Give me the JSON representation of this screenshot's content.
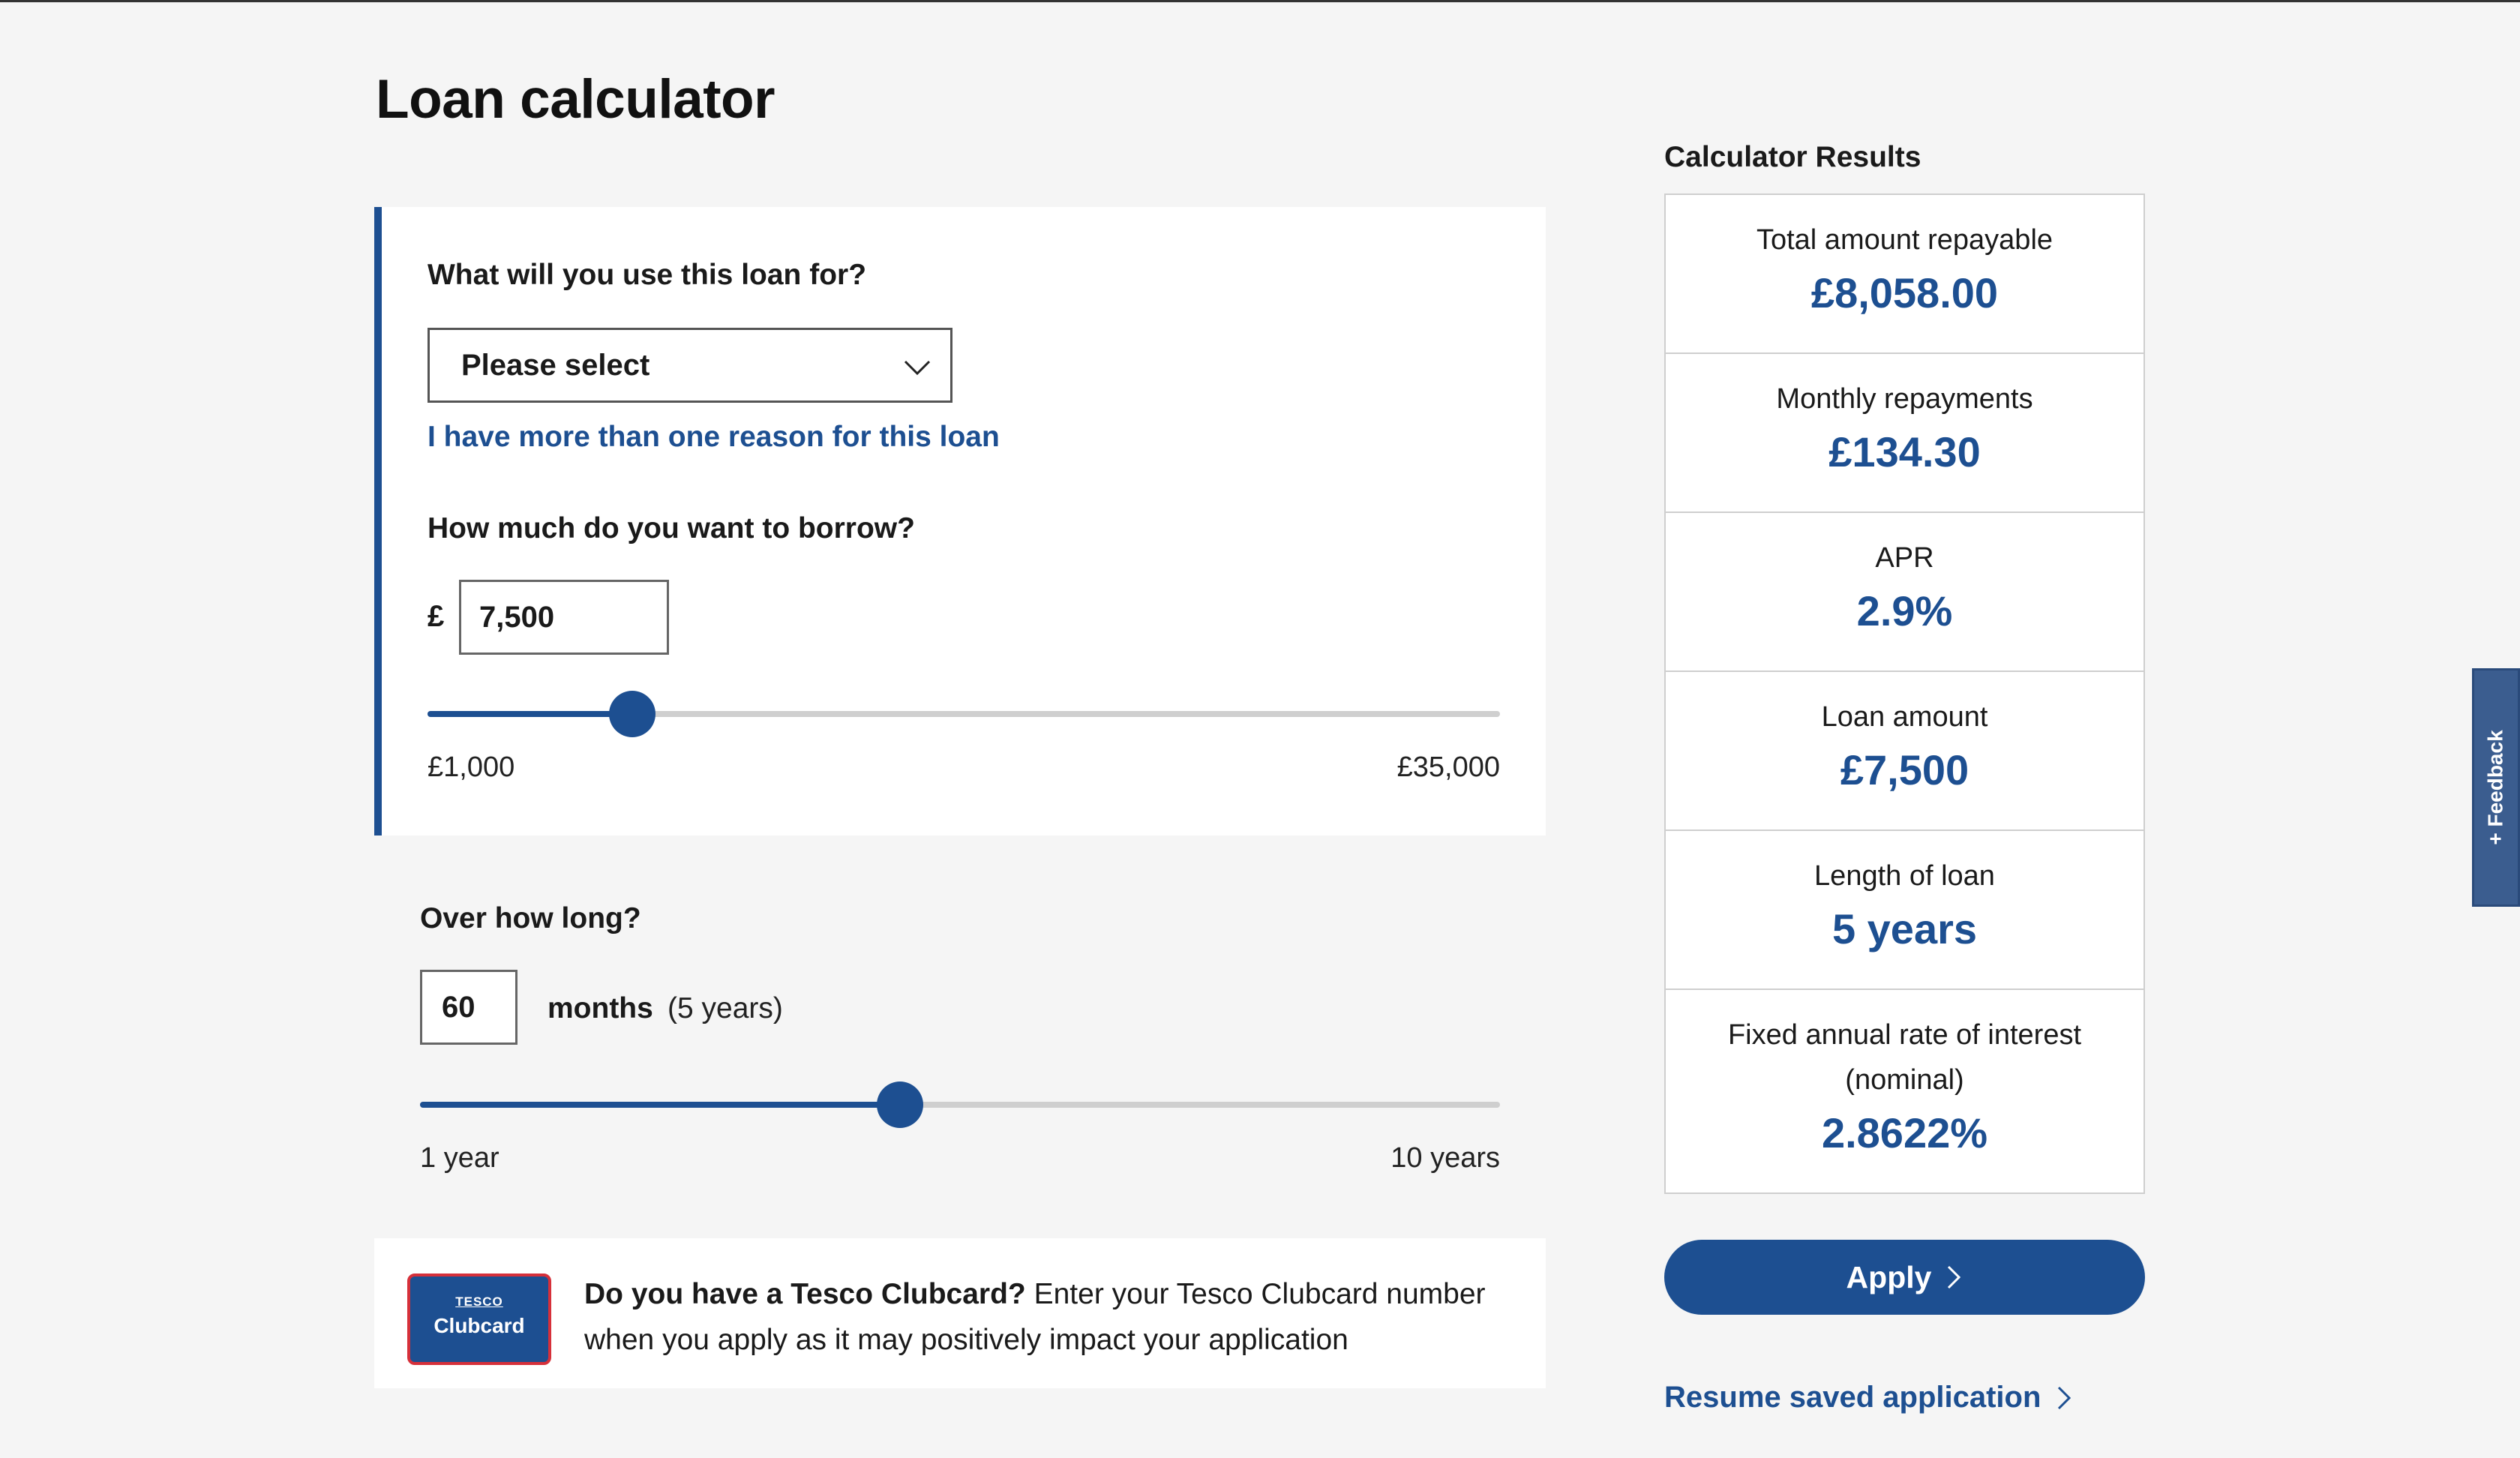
{
  "page": {
    "title": "Loan calculator"
  },
  "purpose": {
    "question": "What will you use this loan for?",
    "select_value": "Please select",
    "more_reasons_link": "I have more than one reason for this loan"
  },
  "borrow": {
    "question": "How much do you want to borrow?",
    "currency_symbol": "£",
    "amount_value": "7,500",
    "min_label": "£1,000",
    "max_label": "£35,000",
    "amount": 7500,
    "min": 1000,
    "max": 35000
  },
  "term": {
    "question": "Over how long?",
    "months_value": "60",
    "months_label": "months",
    "years_note": "(5 years)",
    "min_label": "1 year",
    "max_label": "10 years",
    "months": 60,
    "min": 12,
    "max": 120
  },
  "clubcard": {
    "logo_brand": "TESCO",
    "logo_label": "Clubcard",
    "question": "Do you have a Tesco Clubcard?",
    "message": " Enter your Tesco Clubcard number when you apply as it may positively impact your application"
  },
  "results": {
    "title": "Calculator Results",
    "items": [
      {
        "label": "Total amount repayable",
        "value": "£8,058.00"
      },
      {
        "label": "Monthly repayments",
        "value": "£134.30"
      },
      {
        "label": "APR",
        "value": "2.9%"
      },
      {
        "label": "Loan amount",
        "value": "£7,500"
      },
      {
        "label": "Length of loan",
        "value": "5 years"
      },
      {
        "label": "Fixed annual rate of interest (nominal)",
        "value": "2.8622%"
      }
    ]
  },
  "actions": {
    "apply_label": "Apply",
    "resume_label": "Resume saved application"
  },
  "feedback": {
    "label": "+ Feedback"
  },
  "colors": {
    "brand_blue": "#1d4f91",
    "clubcard_border": "#d6303a",
    "page_bg": "#f5f5f5"
  },
  "icons": {
    "select_chevron": "chevron-down-icon",
    "apply_chevron": "chevron-right-icon",
    "resume_chevron": "chevron-right-icon"
  }
}
